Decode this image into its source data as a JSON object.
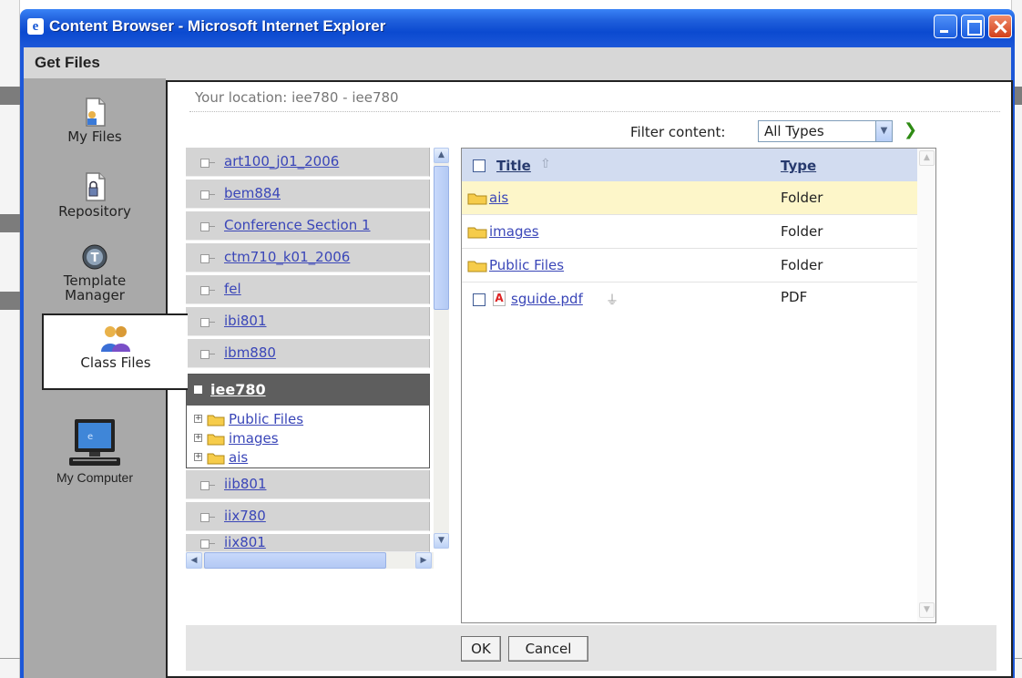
{
  "window": {
    "title": "Content Browser - Microsoft Internet Explorer",
    "heading": "Get Files"
  },
  "nav": {
    "items": [
      {
        "label": "My Files",
        "icon": "my-files-icon"
      },
      {
        "label": "Repository",
        "icon": "repository-icon"
      },
      {
        "label": "Template",
        "label2": "Manager",
        "icon": "template-manager-icon"
      },
      {
        "label": "Class Files",
        "icon": "class-files-icon",
        "selected": true
      },
      {
        "label": "My Computer",
        "icon": "my-computer-icon"
      }
    ]
  },
  "location": "Your location: iee780 - iee780",
  "filter": {
    "label": "Filter content:",
    "value": "All Types"
  },
  "tree": {
    "items_before": [
      "art100_j01_2006",
      "bem884",
      "Conference Section 1",
      "ctm710_k01_2006",
      "fel",
      "ibi801",
      "ibm880"
    ],
    "selected": {
      "label": "iee780",
      "children": [
        "Public Files",
        "images",
        "ais"
      ]
    },
    "items_after": [
      "iib801",
      "iix780",
      "iix801"
    ]
  },
  "filelist": {
    "columns": {
      "title": "Title",
      "type": "Type"
    },
    "rows": [
      {
        "name": "ais",
        "type": "Folder",
        "highlighted": true
      },
      {
        "name": "images",
        "type": "Folder"
      },
      {
        "name": "Public Files",
        "type": "Folder"
      },
      {
        "name": "sguide.pdf",
        "type": "PDF"
      }
    ]
  },
  "buttons": {
    "ok": "OK",
    "cancel": "Cancel"
  },
  "colors": {
    "titlebar": "#0b4ad0",
    "selected_tree": "#5e5e5e",
    "highlight_row": "#fdf6c9",
    "header_row": "#d2dcf0",
    "link": "#3a46b8"
  }
}
